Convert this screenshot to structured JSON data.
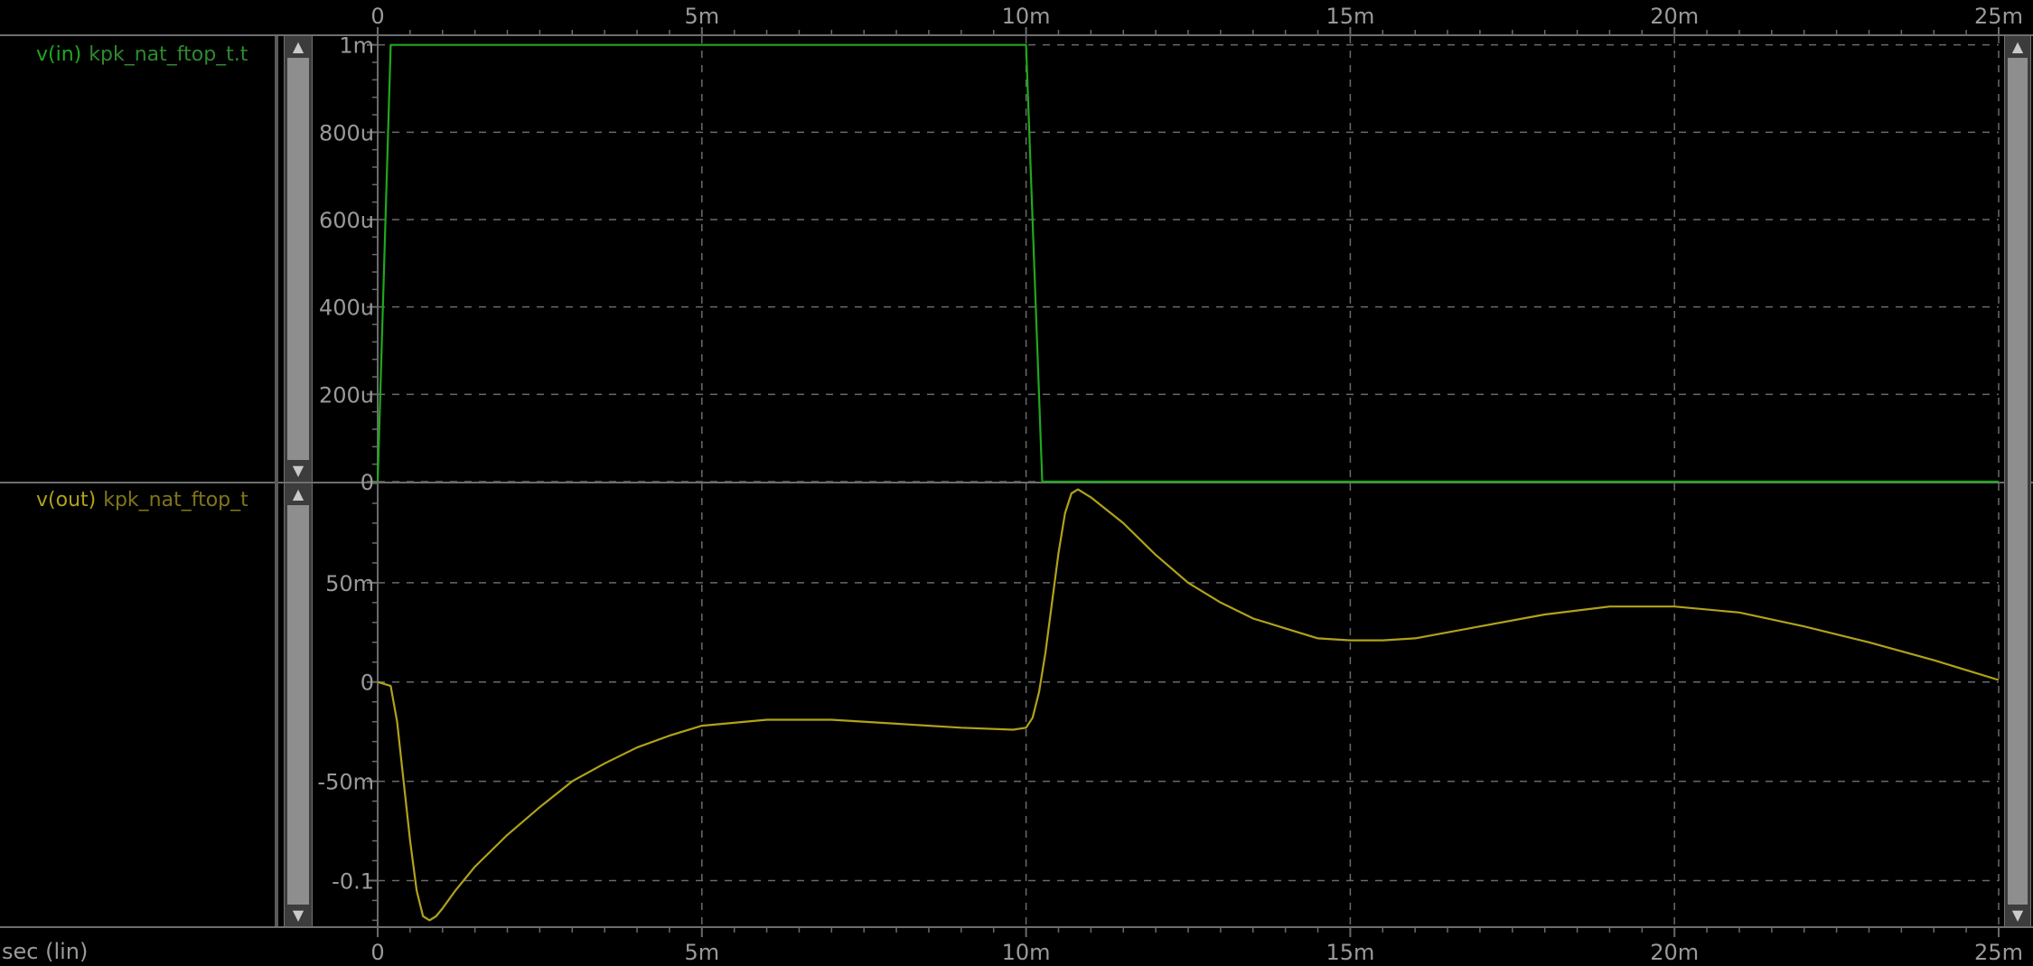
{
  "colors": {
    "background": "#000000",
    "grid": "#6a6a6a",
    "axis_text": "#9a9a9a",
    "in_trace": "#1fa81f",
    "out_trace": "#b0a21a",
    "in_label_name": "#1fa81f",
    "in_label_suffix": "#2f8a2f",
    "out_label_name": "#b0a21a",
    "out_label_suffix": "#80761a"
  },
  "top_axis": {
    "ticks": [
      "0",
      "5m",
      "10m",
      "15m",
      "20m",
      "25m"
    ]
  },
  "bottom_axis": {
    "ticks": [
      "0",
      "5m",
      "10m",
      "15m",
      "20m",
      "25m"
    ],
    "label": "sec (lin)"
  },
  "panels": [
    {
      "trace_name": "v(in)",
      "trace_suffix": "kpk_nat_ftop_t.t"
    },
    {
      "trace_name": "v(out)",
      "trace_suffix": "kpk_nat_ftop_t"
    }
  ],
  "chart_data": [
    {
      "type": "line",
      "title": "",
      "xlabel": "sec (lin)",
      "ylabel": "",
      "grid": true,
      "xlim": [
        0,
        0.025
      ],
      "ylim": [
        0,
        0.00102
      ],
      "x_ticks": [
        "0",
        "5m",
        "10m",
        "15m",
        "20m",
        "25m"
      ],
      "y_ticks": [
        "0",
        "200u",
        "400u",
        "600u",
        "800u",
        "1m"
      ],
      "y_tick_values": [
        0,
        0.0002,
        0.0004,
        0.0006,
        0.0008,
        0.001
      ],
      "series": [
        {
          "name": "v(in)",
          "x": [
            0,
            0.0002,
            0.00025,
            0.01,
            0.01025,
            0.025
          ],
          "y": [
            0,
            0.001,
            0.001,
            0.001,
            0,
            0
          ]
        }
      ]
    },
    {
      "type": "line",
      "title": "",
      "xlabel": "sec (lin)",
      "ylabel": "",
      "grid": true,
      "xlim": [
        0,
        0.025
      ],
      "ylim": [
        -0.123,
        0.1
      ],
      "x_ticks": [
        "0",
        "5m",
        "10m",
        "15m",
        "20m",
        "25m"
      ],
      "y_ticks": [
        "-0.1",
        "-50m",
        "0",
        "50m"
      ],
      "y_tick_values": [
        -0.1,
        -0.05,
        0,
        0.05
      ],
      "series": [
        {
          "name": "v(out)",
          "x": [
            0,
            0.0002,
            0.0003,
            0.0004,
            0.0005,
            0.0006,
            0.0007,
            0.0008,
            0.0009,
            0.001,
            0.0012,
            0.0015,
            0.002,
            0.0025,
            0.003,
            0.0035,
            0.004,
            0.0045,
            0.005,
            0.006,
            0.007,
            0.008,
            0.009,
            0.0098,
            0.01,
            0.0101,
            0.0102,
            0.0103,
            0.0104,
            0.0105,
            0.0106,
            0.0107,
            0.0108,
            0.011,
            0.0115,
            0.012,
            0.0125,
            0.013,
            0.0135,
            0.014,
            0.0145,
            0.015,
            0.0155,
            0.016,
            0.017,
            0.018,
            0.019,
            0.02,
            0.021,
            0.022,
            0.023,
            0.024,
            0.025
          ],
          "y": [
            0,
            -0.002,
            -0.02,
            -0.05,
            -0.08,
            -0.105,
            -0.118,
            -0.12,
            -0.118,
            -0.114,
            -0.105,
            -0.093,
            -0.077,
            -0.063,
            -0.05,
            -0.041,
            -0.033,
            -0.027,
            -0.022,
            -0.019,
            -0.019,
            -0.021,
            -0.023,
            -0.024,
            -0.023,
            -0.018,
            -0.005,
            0.015,
            0.04,
            0.065,
            0.085,
            0.095,
            0.097,
            0.093,
            0.08,
            0.064,
            0.05,
            0.04,
            0.032,
            0.027,
            0.022,
            0.021,
            0.021,
            0.022,
            0.028,
            0.034,
            0.038,
            0.038,
            0.035,
            0.028,
            0.02,
            0.011,
            0.001
          ]
        }
      ]
    }
  ]
}
